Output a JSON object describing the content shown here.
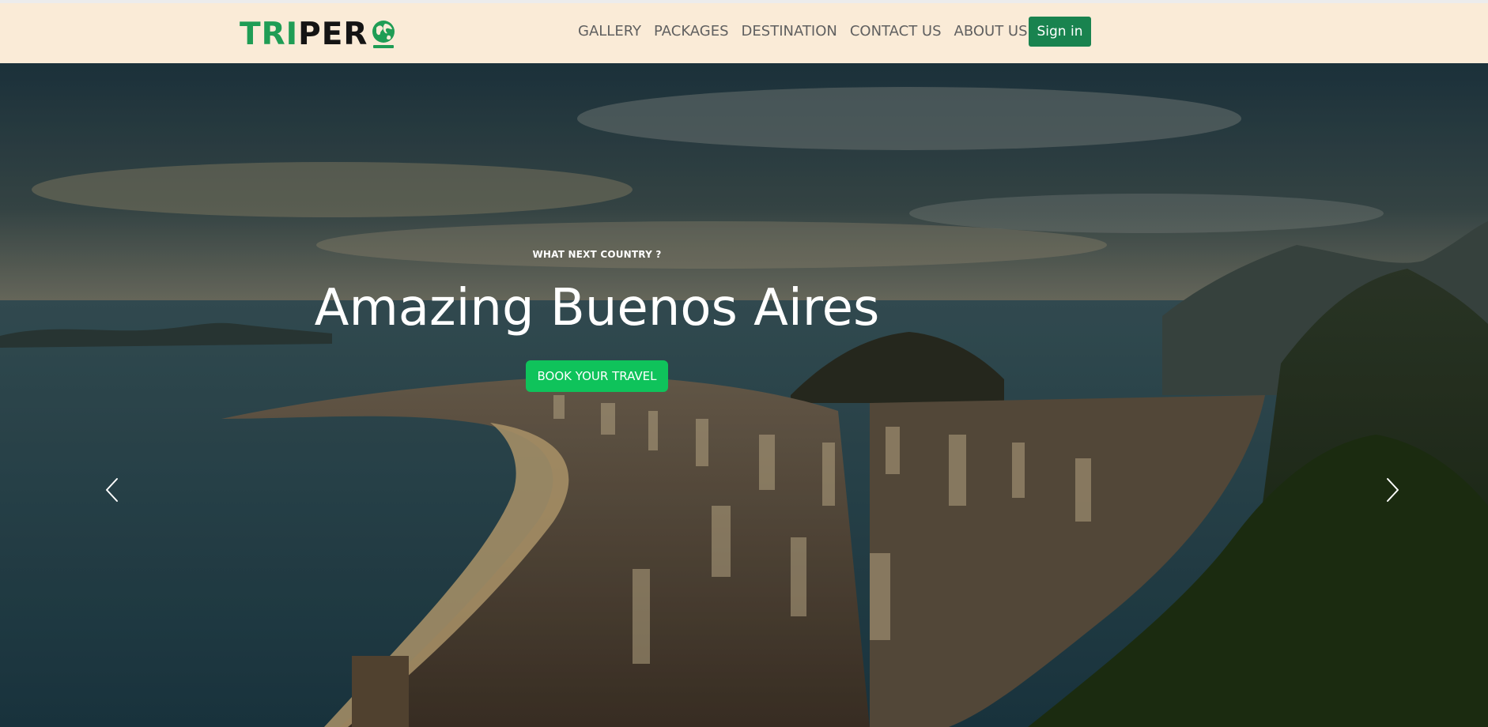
{
  "brand": {
    "part1": "TRI",
    "part2": "PER",
    "tri_color": "#1f9d55",
    "per_color": "#141414",
    "logo_icon": "globe-icon"
  },
  "nav": {
    "items": [
      {
        "label": "GALLERY"
      },
      {
        "label": "PACKAGES"
      },
      {
        "label": "DESTINATION"
      },
      {
        "label": "CONTACT US"
      },
      {
        "label": "ABOUT US"
      }
    ],
    "signin_label": "Sign in",
    "background": "#faebd7",
    "signin_color": "#19834f"
  },
  "hero": {
    "kicker": "WHAT NEXT COUNTRY ?",
    "title": "Amazing Buenos Aires",
    "cta_label": "BOOK YOUR TRAVEL",
    "cta_color": "#0fc35b",
    "prev_icon": "chevron-left-icon",
    "next_icon": "chevron-right-icon"
  }
}
